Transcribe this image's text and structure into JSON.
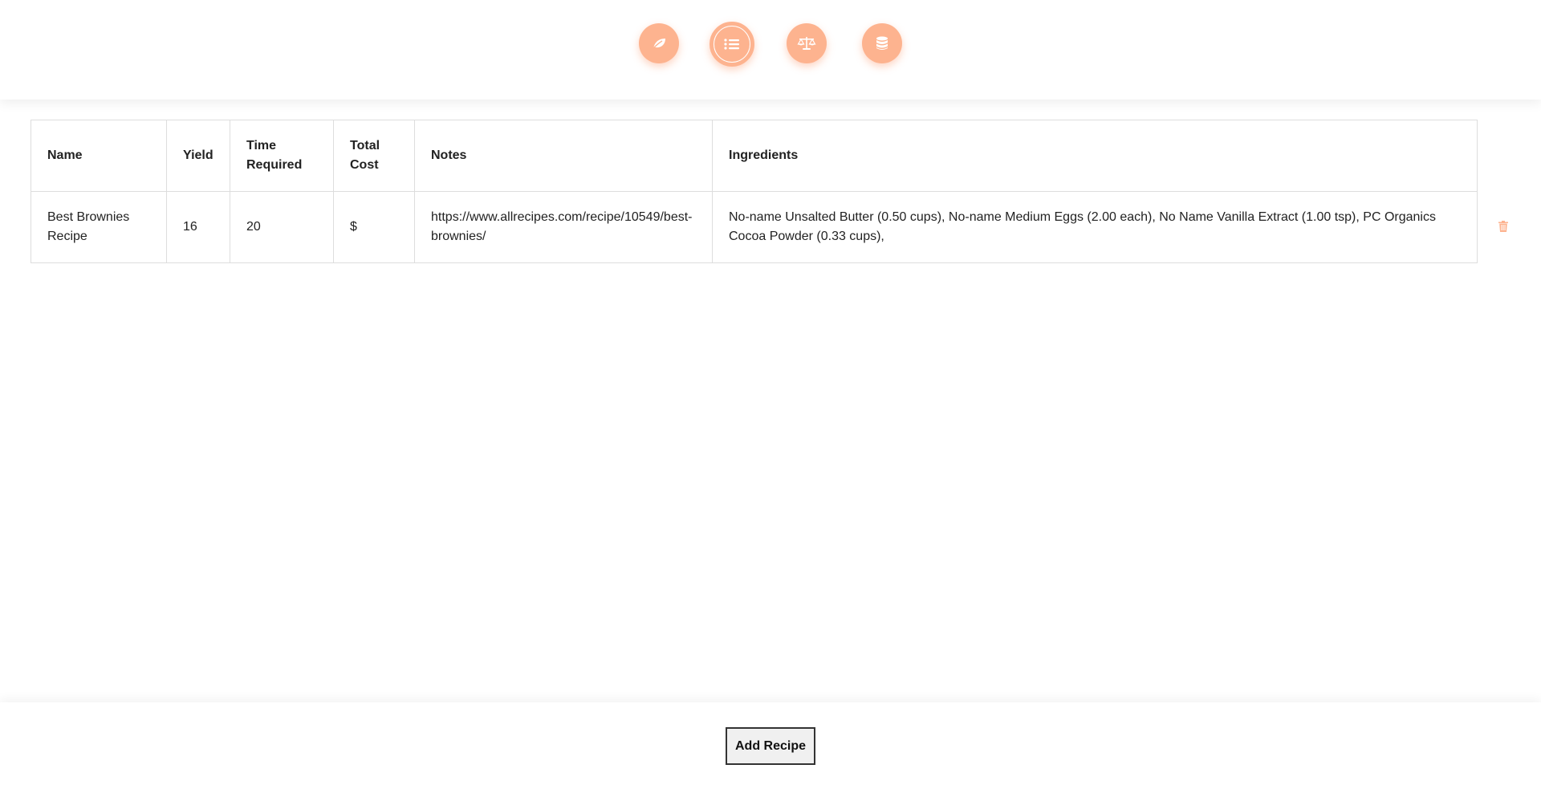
{
  "nav": {
    "items": [
      {
        "icon": "leaf-icon",
        "active": false
      },
      {
        "icon": "list-icon",
        "active": true
      },
      {
        "icon": "balance-scale-icon",
        "active": false
      },
      {
        "icon": "database-icon",
        "active": false
      }
    ],
    "accent_color": "#fdb38f"
  },
  "table": {
    "headers": {
      "name": "Name",
      "yield": "Yield",
      "time": "Time Required",
      "cost": "Total Cost",
      "notes": "Notes",
      "ingredients": "Ingredients"
    },
    "rows": [
      {
        "name": "Best Brownies Recipe",
        "yield": "16",
        "time": "20",
        "cost": "$",
        "notes": "https://www.allrecipes.com/recipe/10549/best-brownies/",
        "ingredients": "No-name Unsalted Butter (0.50 cups), No-name Medium Eggs (2.00 each), No Name Vanilla Extract (1.00 tsp), PC Organics Cocoa Powder (0.33 cups),"
      }
    ]
  },
  "footer": {
    "add_label": "Add Recipe"
  }
}
